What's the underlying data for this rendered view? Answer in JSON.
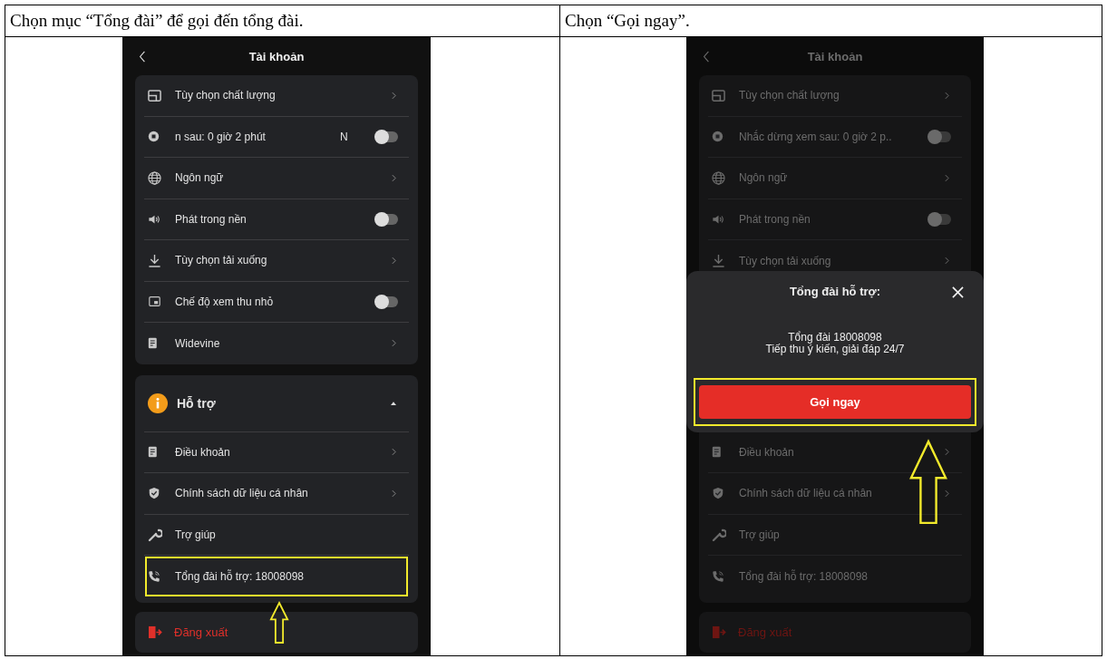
{
  "table": {
    "columns": [
      {
        "instruction": "Chọn mục “Tổng đài” để gọi đến tổng đài."
      },
      {
        "instruction": "Chọn “Gọi ngay”."
      }
    ]
  },
  "phones": [
    {
      "title": "Tài khoản",
      "dimmed": false,
      "settings": [
        {
          "kind": "link",
          "label": "Tùy chọn chất lượng"
        },
        {
          "kind": "toggle",
          "label": "n sau: 0 giờ 2 phút",
          "trailing": "N",
          "on": false
        },
        {
          "kind": "link",
          "label": "Ngôn ngữ"
        },
        {
          "kind": "toggle",
          "label": "Phát trong nền",
          "on": false
        },
        {
          "kind": "link",
          "label": "Tùy chọn tải xuống"
        },
        {
          "kind": "toggle",
          "label": "Chế độ xem thu nhỏ",
          "on": false
        },
        {
          "kind": "link",
          "label": "Widevine"
        }
      ],
      "support": {
        "label": "Hỗ trợ",
        "expanded": true,
        "items": [
          {
            "kind": "link",
            "label": "Điều khoản",
            "highlighted": false
          },
          {
            "kind": "link",
            "label": "Chính sách dữ liệu cá nhân",
            "highlighted": false
          },
          {
            "kind": "plain",
            "label": "Trợ giúp",
            "highlighted": false
          },
          {
            "kind": "plain",
            "label": "Tổng đài hỗ trợ: 18008098",
            "highlighted": true
          }
        ]
      },
      "logout": "Đăng xuất"
    },
    {
      "title": "Tài khoản",
      "dimmed": true,
      "settings": [
        {
          "kind": "link",
          "label": "Tùy chọn chất lượng"
        },
        {
          "kind": "toggle",
          "label": "Nhắc dừng xem sau: 0 giờ 2 p..",
          "on": false
        },
        {
          "kind": "link",
          "label": "Ngôn ngữ"
        },
        {
          "kind": "toggle",
          "label": "Phát trong nền",
          "on": false
        },
        {
          "kind": "link",
          "label": "Tùy chọn tải xuống"
        }
      ],
      "sheet": {
        "title": "Tổng đài hỗ trợ:",
        "lines": [
          "Tổng đài 18008098",
          "Tiếp thu ý kiến, giải đáp 24/7"
        ],
        "button": "Gọi ngay",
        "highlighted": true
      },
      "support": {
        "items": [
          {
            "kind": "link",
            "label": "Điều khoản",
            "highlighted": false
          },
          {
            "kind": "link",
            "label": "Chính sách dữ liệu cá nhân",
            "highlighted": false
          },
          {
            "kind": "plain",
            "label": "Trợ giúp",
            "highlighted": false
          },
          {
            "kind": "plain",
            "label": "Tổng đài hỗ trợ: 18008098",
            "highlighted": false
          }
        ]
      },
      "logout": "Đăng xuất"
    }
  ]
}
